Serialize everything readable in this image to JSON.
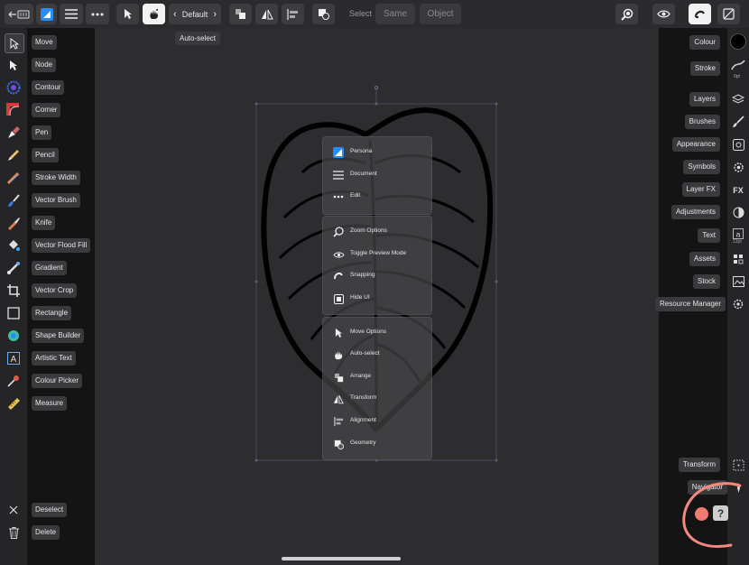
{
  "topbar": {
    "back_label": "",
    "default_label": "Default",
    "select_label": "Select",
    "same_label": "Same",
    "object_label": "Object"
  },
  "tooltip": "Auto-select",
  "left_tools": [
    {
      "label": "Move",
      "icon": "move-arrow-icon"
    },
    {
      "label": "Node",
      "icon": "node-arrow-icon"
    },
    {
      "label": "Contour",
      "icon": "contour-icon"
    },
    {
      "label": "Corner",
      "icon": "corner-icon"
    },
    {
      "label": "Pen",
      "icon": "pen-icon"
    },
    {
      "label": "Pencil",
      "icon": "pencil-icon"
    },
    {
      "label": "Stroke Width",
      "icon": "stroke-width-icon"
    },
    {
      "label": "Vector Brush",
      "icon": "vector-brush-icon"
    },
    {
      "label": "Knife",
      "icon": "knife-icon"
    },
    {
      "label": "Vector Flood Fill",
      "icon": "flood-fill-icon"
    },
    {
      "label": "Gradient",
      "icon": "gradient-icon"
    },
    {
      "label": "Vector Crop",
      "icon": "crop-icon"
    },
    {
      "label": "Rectangle",
      "icon": "rectangle-icon"
    },
    {
      "label": "Shape Builder",
      "icon": "shape-builder-icon"
    },
    {
      "label": "Artistic Text",
      "icon": "artistic-text-icon"
    },
    {
      "label": "Colour Picker",
      "icon": "colour-picker-icon"
    },
    {
      "label": "Measure",
      "icon": "measure-icon"
    }
  ],
  "left_bottom": [
    {
      "label": "Deselect",
      "icon": "close-icon"
    },
    {
      "label": "Delete",
      "icon": "trash-icon"
    }
  ],
  "right_panels": [
    {
      "label": "Colour"
    },
    {
      "label": "Stroke"
    },
    {
      "label": "Layers"
    },
    {
      "label": "Brushes"
    },
    {
      "label": "Appearance"
    },
    {
      "label": "Symbols"
    },
    {
      "label": "Layer FX"
    },
    {
      "label": "Adjustments"
    },
    {
      "label": "Text"
    },
    {
      "label": "Assets"
    },
    {
      "label": "Stock"
    },
    {
      "label": "Resource Manager"
    }
  ],
  "right_bottom": {
    "transform_label": "Transform",
    "navigator_label": "Navigator",
    "stroke_size": "0pt",
    "text_size": "12pt"
  },
  "menu_groups": [
    [
      {
        "label": "Persona",
        "icon": "persona-icon"
      },
      {
        "label": "Document",
        "icon": "hamburger-icon"
      },
      {
        "label": "Edit",
        "icon": "more-dots-icon"
      }
    ],
    [
      {
        "label": "Zoom Options",
        "icon": "zoom-icon"
      },
      {
        "label": "Toggle Preview Mode",
        "icon": "preview-eye-icon"
      },
      {
        "label": "Snapping",
        "icon": "snapping-magnet-icon"
      },
      {
        "label": "Hide UI",
        "icon": "hide-ui-icon"
      }
    ],
    [
      {
        "label": "Move Options",
        "icon": "move-arrow-icon"
      },
      {
        "label": "Auto-select",
        "icon": "auto-select-hand-icon"
      },
      {
        "label": "Arrange",
        "icon": "arrange-icon"
      },
      {
        "label": "Transform",
        "icon": "transform-flip-icon"
      },
      {
        "label": "Alignment",
        "icon": "alignment-icon"
      },
      {
        "label": "Geometry",
        "icon": "geometry-icon"
      }
    ]
  ],
  "colors": {
    "accent_blue": "#2a8cf0",
    "highlight_circle": "#f08a80",
    "help_badge": "#f27b6f"
  }
}
